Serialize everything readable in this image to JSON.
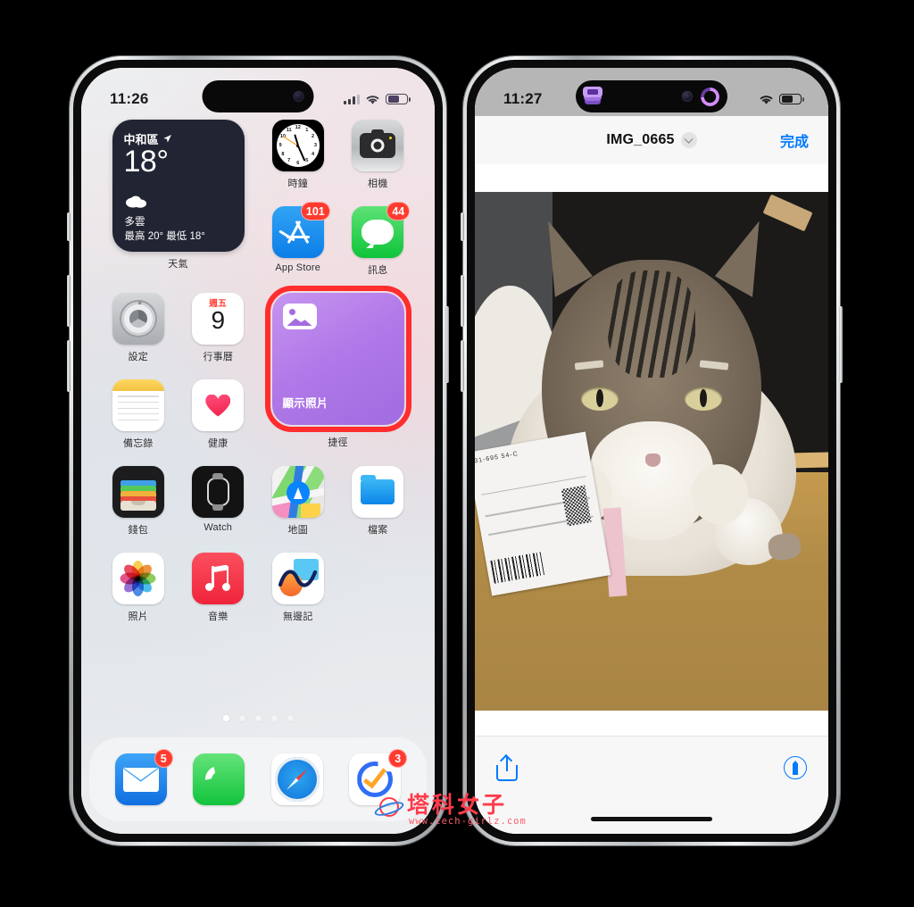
{
  "left_phone": {
    "status_bar": {
      "time": "11:26",
      "signal": "cellular-bars",
      "wifi": "wifi-icon",
      "battery": "battery-icon"
    },
    "weather_widget": {
      "location": "中和區",
      "temperature": "18°",
      "condition": "多雲",
      "high_low": "最高 20° 最低 18°",
      "app_label": "天氣"
    },
    "shortcut_widget": {
      "title": "顯示照片",
      "app_label": "捷徑",
      "highlight_color": "#ff2d2d",
      "tint": "#b078e8"
    },
    "apps": [
      {
        "name": "時鐘",
        "icon": "clock-icon",
        "badge": ""
      },
      {
        "name": "相機",
        "icon": "camera-icon",
        "badge": ""
      },
      {
        "name": "App Store",
        "icon": "appstore-icon",
        "badge": "101"
      },
      {
        "name": "訊息",
        "icon": "messages-icon",
        "badge": "44"
      },
      {
        "name": "設定",
        "icon": "settings-icon",
        "badge": ""
      },
      {
        "name": "行事曆",
        "icon": "calendar-icon",
        "badge": ""
      },
      {
        "name": "備忘錄",
        "icon": "notes-icon",
        "badge": ""
      },
      {
        "name": "健康",
        "icon": "health-icon",
        "badge": ""
      },
      {
        "name": "錢包",
        "icon": "wallet-icon",
        "badge": ""
      },
      {
        "name": "Watch",
        "icon": "watch-icon",
        "badge": ""
      },
      {
        "name": "地圖",
        "icon": "maps-icon",
        "badge": ""
      },
      {
        "name": "檔案",
        "icon": "files-icon",
        "badge": ""
      },
      {
        "name": "照片",
        "icon": "photos-icon",
        "badge": ""
      },
      {
        "name": "音樂",
        "icon": "music-icon",
        "badge": ""
      },
      {
        "name": "無邊記",
        "icon": "freeform-icon",
        "badge": ""
      }
    ],
    "calendar": {
      "weekday": "週五",
      "day": "9"
    },
    "page_dots": {
      "count": 5,
      "active_index": 0
    },
    "dock": [
      {
        "name": "郵件",
        "icon": "mail-icon",
        "badge": "5"
      },
      {
        "name": "電話",
        "icon": "phone-icon",
        "badge": ""
      },
      {
        "name": "Safari",
        "icon": "safari-icon",
        "badge": ""
      },
      {
        "name": "提醒事項",
        "icon": "reminders-icon",
        "badge": "3"
      }
    ]
  },
  "right_phone": {
    "status_bar": {
      "time": "11:27",
      "live_activity": "shortcuts-icon",
      "progress_ring": "progress-ring-icon",
      "wifi": "wifi-icon",
      "battery": "battery-icon"
    },
    "nav_bar": {
      "title": "IMG_0665",
      "title_chevron": "chevron-down-icon",
      "done_label": "完成",
      "done_color": "#007aff"
    },
    "photo": {
      "alt": "tabby-cat-on-cardboard-box"
    },
    "bottom_bar": {
      "share": "share-icon",
      "markup": "markup-pen-icon",
      "home_indicator": "home-indicator"
    }
  },
  "watermark": {
    "name": "塔科女子",
    "url": "www.tech-girlz.com",
    "color": "#ff3b4a"
  }
}
